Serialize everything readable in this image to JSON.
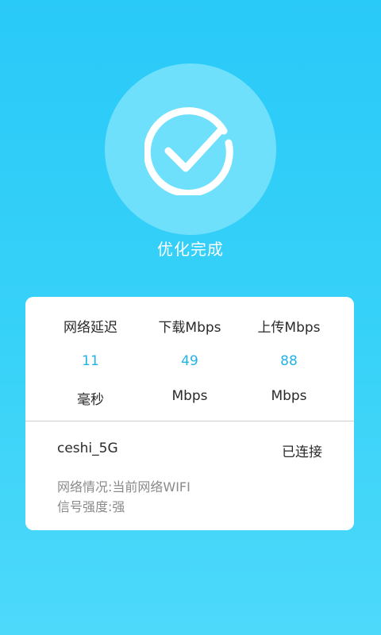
{
  "result": {
    "icon": "check-circle-icon",
    "title": "优化完成"
  },
  "stats": [
    {
      "label": "网络延迟",
      "value": "11",
      "unit": "毫秒"
    },
    {
      "label": "下载Mbps",
      "value": "49",
      "unit": "Mbps"
    },
    {
      "label": "上传Mbps",
      "value": "88",
      "unit": "Mbps"
    }
  ],
  "network": {
    "ssid": "ceshi_5G",
    "status": "已连接",
    "info_line1": "网络情况:当前网络WIFI",
    "info_line2": "信号强度:强"
  },
  "colors": {
    "background": "#29c9f8",
    "circle": "#6ee0fb",
    "value_accent": "#22b3e4"
  }
}
